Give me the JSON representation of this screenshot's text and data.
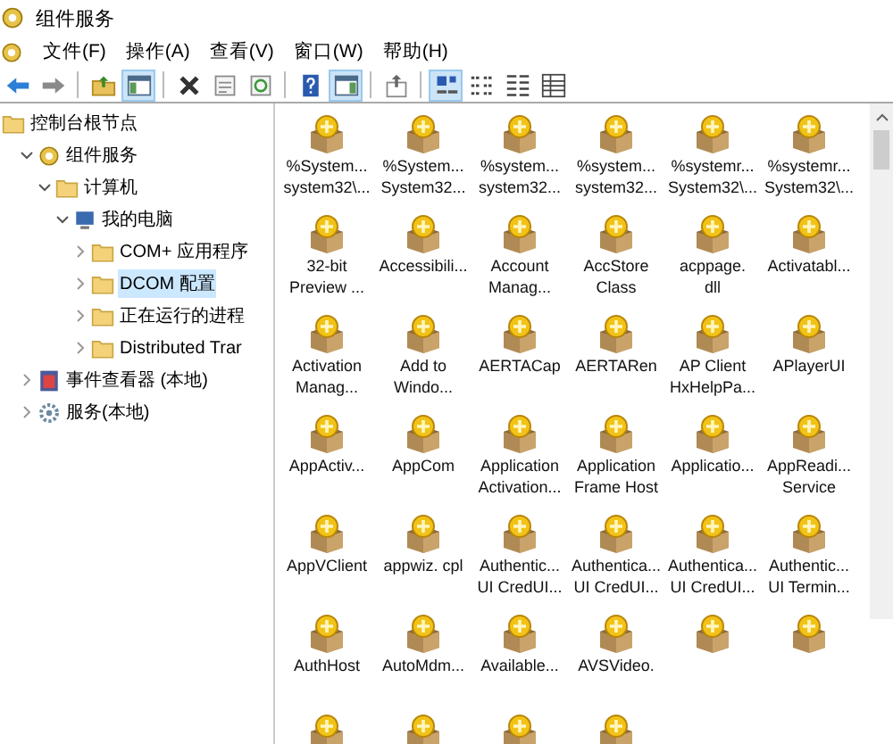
{
  "window": {
    "title": "组件服务"
  },
  "menu": [
    "文件(F)",
    "操作(A)",
    "查看(V)",
    "窗口(W)",
    "帮助(H)"
  ],
  "toolbar": [
    {
      "kind": "back",
      "selected": false
    },
    {
      "kind": "forward",
      "selected": false
    },
    {
      "kind": "sep"
    },
    {
      "kind": "up",
      "selected": false
    },
    {
      "kind": "tree",
      "selected": true
    },
    {
      "kind": "sep"
    },
    {
      "kind": "delete",
      "selected": false
    },
    {
      "kind": "properties",
      "selected": false
    },
    {
      "kind": "refresh",
      "selected": false
    },
    {
      "kind": "sep"
    },
    {
      "kind": "help",
      "selected": false
    },
    {
      "kind": "actionpane",
      "selected": true
    },
    {
      "kind": "sep"
    },
    {
      "kind": "export",
      "selected": false
    },
    {
      "kind": "sep"
    },
    {
      "kind": "largeicons",
      "selected": true
    },
    {
      "kind": "smallicons",
      "selected": false
    },
    {
      "kind": "list",
      "selected": false
    },
    {
      "kind": "details",
      "selected": false
    }
  ],
  "tree": [
    {
      "label": "控制台根节点",
      "kind": "folder",
      "selected": false,
      "children": [
        {
          "label": "组件服务",
          "kind": "component",
          "expanded": true,
          "selected": false,
          "children": [
            {
              "label": "计算机",
              "kind": "folder",
              "expanded": true,
              "selected": false,
              "children": [
                {
                  "label": "我的电脑",
                  "kind": "computer",
                  "expanded": true,
                  "selected": false,
                  "children": [
                    {
                      "label": "COM+ 应用程序",
                      "kind": "folder",
                      "expanded": false,
                      "selected": false
                    },
                    {
                      "label": "DCOM 配置",
                      "kind": "folder",
                      "expanded": false,
                      "selected": true
                    },
                    {
                      "label": "正在运行的进程",
                      "kind": "folder",
                      "expanded": false,
                      "selected": false
                    },
                    {
                      "label": "Distributed Trar",
                      "kind": "folder",
                      "expanded": false,
                      "selected": false
                    }
                  ]
                }
              ]
            }
          ]
        },
        {
          "label": "事件查看器 (本地)",
          "kind": "eventlog",
          "expanded": false,
          "selected": false
        },
        {
          "label": "服务(本地)",
          "kind": "gear",
          "expanded": false,
          "selected": false
        }
      ]
    }
  ],
  "items": [
    {
      "lines": [
        "%System...",
        "system32\\..."
      ]
    },
    {
      "lines": [
        "%System...",
        "System32..."
      ]
    },
    {
      "lines": [
        "%system...",
        "system32..."
      ]
    },
    {
      "lines": [
        "%system...",
        "system32..."
      ]
    },
    {
      "lines": [
        "%systemr...",
        "System32\\..."
      ]
    },
    {
      "lines": [
        "%systemr...",
        "System32\\..."
      ]
    },
    {
      "lines": [
        "32-bit",
        "Preview ..."
      ]
    },
    {
      "lines": [
        "Accessibili..."
      ]
    },
    {
      "lines": [
        "Account",
        "Manag..."
      ]
    },
    {
      "lines": [
        "AccStore",
        "Class"
      ]
    },
    {
      "lines": [
        "acppage.",
        "dll"
      ]
    },
    {
      "lines": [
        "Activatabl..."
      ]
    },
    {
      "lines": [
        "Activation",
        "Manag..."
      ]
    },
    {
      "lines": [
        "Add to",
        "Windo..."
      ]
    },
    {
      "lines": [
        "AERTACap"
      ]
    },
    {
      "lines": [
        "AERTARen"
      ]
    },
    {
      "lines": [
        "AP Client",
        "HxHelpPa..."
      ]
    },
    {
      "lines": [
        "APlayerUI"
      ]
    },
    {
      "lines": [
        "AppActiv..."
      ]
    },
    {
      "lines": [
        "AppCom"
      ]
    },
    {
      "lines": [
        "Application",
        "Activation..."
      ]
    },
    {
      "lines": [
        "Application",
        "Frame Host"
      ]
    },
    {
      "lines": [
        "Applicatio..."
      ]
    },
    {
      "lines": [
        "AppReadi...",
        "Service"
      ]
    },
    {
      "lines": [
        "AppVClient"
      ]
    },
    {
      "lines": [
        "appwiz. cpl"
      ]
    },
    {
      "lines": [
        "Authentic...",
        "UI CredUI..."
      ]
    },
    {
      "lines": [
        "Authentica...",
        "UI CredUI..."
      ]
    },
    {
      "lines": [
        "Authentica...",
        "UI CredUI..."
      ]
    },
    {
      "lines": [
        "Authentic...",
        "UI Termin..."
      ]
    },
    {
      "lines": [
        "AuthHost"
      ]
    },
    {
      "lines": [
        "AutoMdm..."
      ]
    },
    {
      "lines": [
        "Available..."
      ]
    },
    {
      "lines": [
        "AVSVideo."
      ]
    },
    {
      "kind": "icon"
    },
    {
      "kind": "icon"
    },
    {
      "kind": "icon"
    },
    {
      "kind": "icon"
    },
    {
      "kind": "icon"
    },
    {
      "kind": "icon"
    }
  ]
}
